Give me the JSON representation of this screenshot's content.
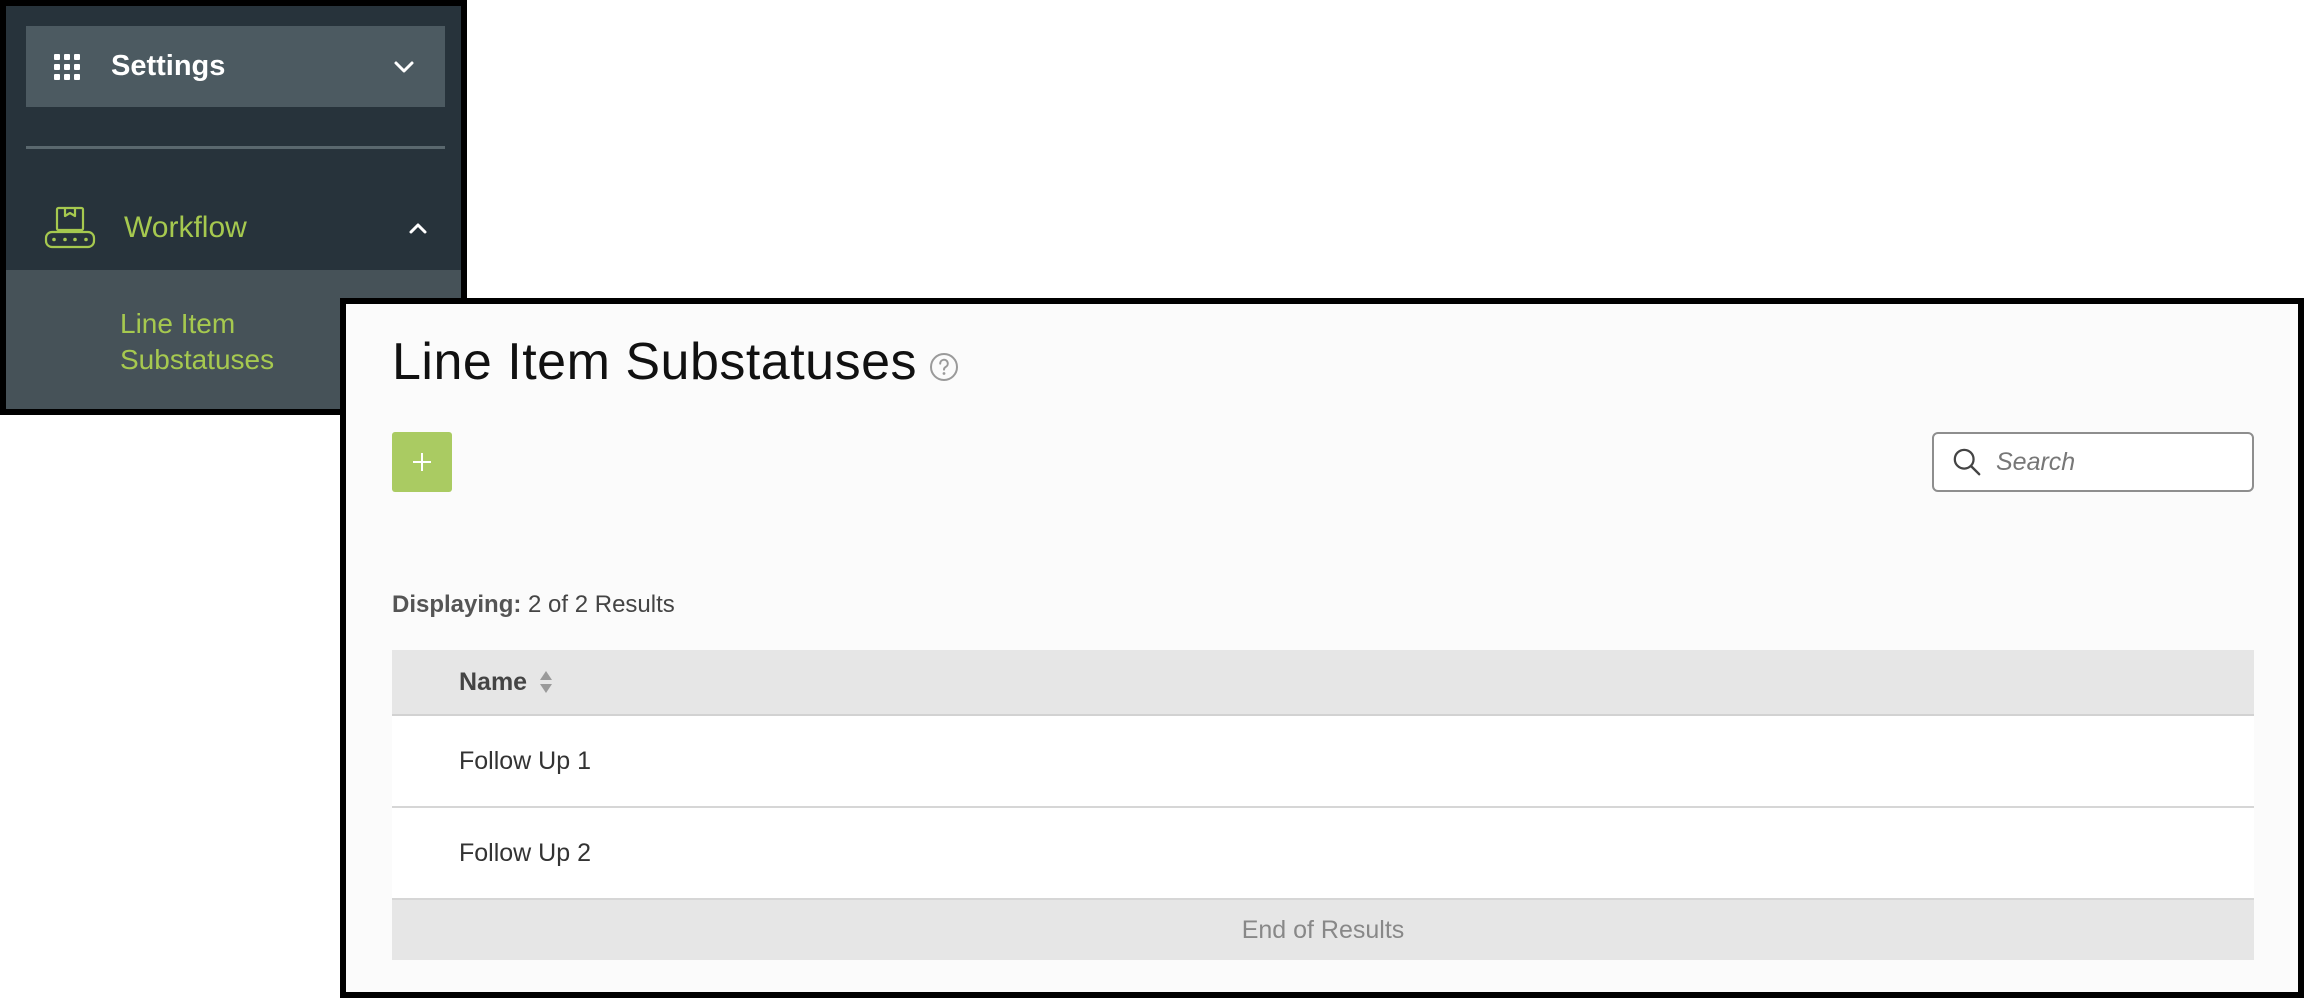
{
  "sidebar": {
    "settings": {
      "label": "Settings",
      "icon": "grid-icon"
    },
    "workflow": {
      "label": "Workflow",
      "icon": "conveyor-icon"
    },
    "active_item": {
      "label": "Line Item Substatuses"
    }
  },
  "page": {
    "title": "Line Item Substatuses",
    "help_icon": "help-circle-icon"
  },
  "toolbar": {
    "add_label": "+",
    "search_placeholder": "Search"
  },
  "results": {
    "displaying_label": "Displaying:",
    "displaying_value": "2 of 2 Results"
  },
  "table": {
    "columns": [
      {
        "label": "Name",
        "sortable": true
      }
    ],
    "rows": [
      {
        "name": "Follow Up 1"
      },
      {
        "name": "Follow Up 2"
      }
    ],
    "footer": "End of Results"
  },
  "colors": {
    "sidebar_bg": "#27333b",
    "accent_green": "#a6c94f",
    "add_button": "#aacb62"
  }
}
